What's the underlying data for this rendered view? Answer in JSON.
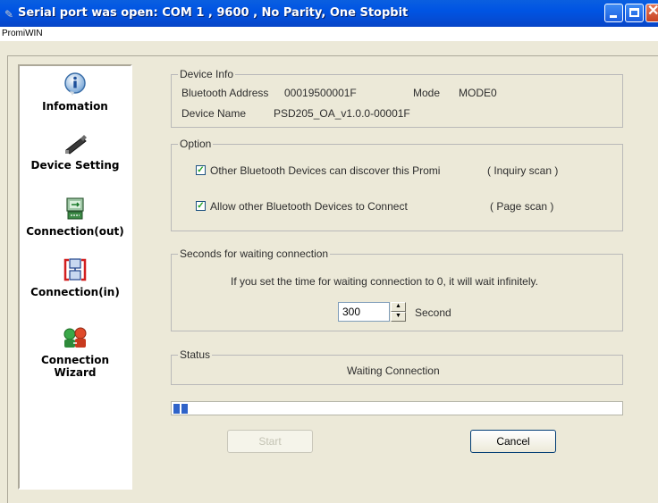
{
  "window": {
    "title": "Serial port was open: COM 1 , 9600 , No Parity, One Stopbit",
    "app_name": "PromiWIN",
    "controls": [
      "minimize",
      "maximize",
      "close"
    ]
  },
  "sidebar": {
    "items": [
      {
        "label": "Infomation",
        "icon": "info-icon"
      },
      {
        "label": "Device Setting",
        "icon": "device-icon"
      },
      {
        "label": "Connection(out)",
        "icon": "connection-out-icon"
      },
      {
        "label": "Connection(in)",
        "icon": "connection-in-icon"
      },
      {
        "label": "Connection Wizard",
        "icon": "wizard-icon"
      }
    ]
  },
  "device_info": {
    "title": "Device Info",
    "bt_address_label": "Bluetooth Address",
    "bt_address": "00019500001F",
    "mode_label": "Mode",
    "mode": "MODE0",
    "device_name_label": "Device Name",
    "device_name": "PSD205_OA_v1.0.0-00001F"
  },
  "option": {
    "title": "Option",
    "discover_label": "Other Bluetooth Devices can discover this Promi",
    "discover_checked": true,
    "discover_note": "( Inquiry scan )",
    "connect_label": "Allow other Bluetooth Devices to Connect",
    "connect_checked": true,
    "connect_note": "( Page scan )"
  },
  "waiting": {
    "title": "Seconds for waiting connection",
    "hint": "If you set the time for waiting connection to 0, it will wait infinitely.",
    "value": "300",
    "unit": "Second"
  },
  "status": {
    "title": "Status",
    "text": "Waiting Connection"
  },
  "progress": {
    "value": 0.04,
    "color": "#2f63c9"
  },
  "buttons": {
    "start": "Start",
    "cancel": "Cancel"
  },
  "colors": {
    "titlebar": "#0054e3",
    "face": "#ece9d8"
  }
}
